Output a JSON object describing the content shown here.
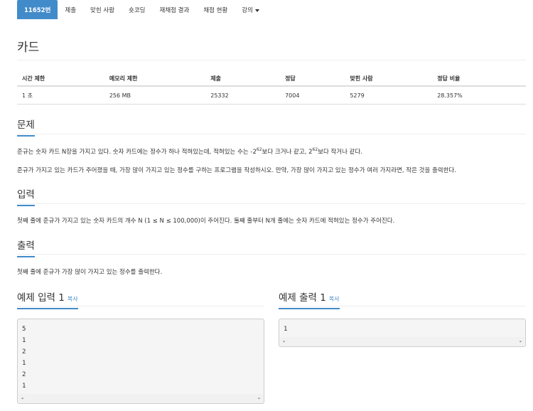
{
  "nav": {
    "items": [
      "11652번",
      "제출",
      "맞힌 사람",
      "숏코딩",
      "재채점 결과",
      "채점 현황",
      "강의"
    ]
  },
  "problem": {
    "title": "카드"
  },
  "info_table": {
    "headers": [
      "시간 제한",
      "메모리 제한",
      "제출",
      "정답",
      "맞힌 사람",
      "정답 비율"
    ],
    "values": [
      "1 초",
      "256 MB",
      "25332",
      "7004",
      "5279",
      "28.357%"
    ]
  },
  "sections": {
    "problem": {
      "heading": "문제",
      "p1": {
        "pre": "준규는 숫자 카드 N장을 가지고 있다. 숫자 카드에는 정수가 하나 적혀있는데, 적혀있는 수는 -2",
        "sup1": "62",
        "mid": "보다 크거나 같고, 2",
        "sup2": "62",
        "post": "보다 작거나 같다."
      },
      "p2": "준규가 가지고 있는 카드가 주어졌을 때, 가장 많이 가지고 있는 정수를 구하는 프로그램을 작성하시오. 만약, 가장 많이 가지고 있는 정수가 여러 가지라면, 작은 것을 출력한다."
    },
    "input": {
      "heading": "입력",
      "p": "첫째 줄에 준규가 가지고 있는 숫자 카드의 개수 N (1 ≤ N ≤ 100,000)이 주어진다. 둘째 줄부터 N개 줄에는 숫자 카드에 적혀있는 정수가 주어진다."
    },
    "output": {
      "heading": "출력",
      "p": "첫째 줄에 준규가 가장 많이 가지고 있는 정수를 출력한다."
    }
  },
  "examples": {
    "input_heading": "예제 입력 1",
    "output_heading": "예제 출력 1",
    "copy_label": "복사",
    "input_text": "5\n1\n2\n1\n2\n1",
    "output_text": "1"
  },
  "colors": {
    "accent": "#428bca",
    "rule": "#eeeeee",
    "pre_bg": "#f5f5f5"
  }
}
